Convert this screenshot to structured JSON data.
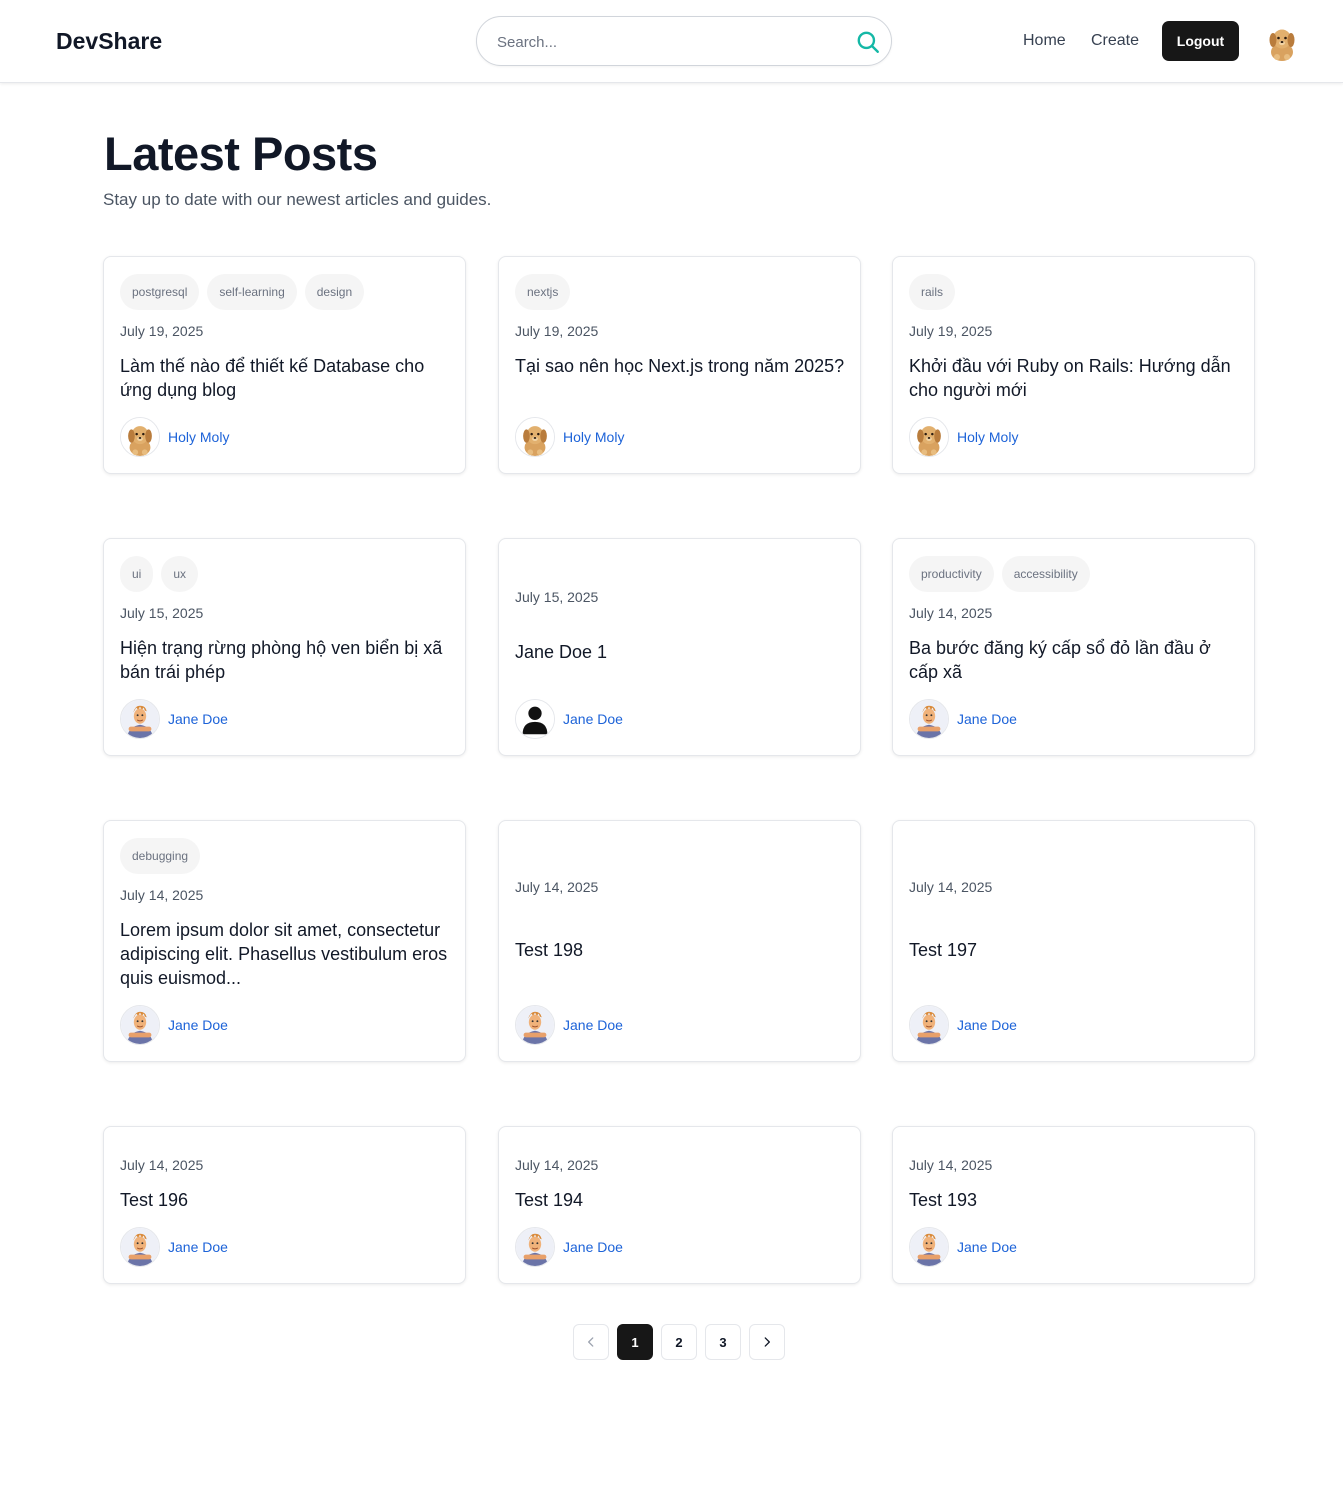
{
  "header": {
    "logo": "DevShare",
    "search_placeholder": "Search...",
    "nav": {
      "home": "Home",
      "create": "Create",
      "logout": "Logout"
    },
    "accent_color": "#14b8a6"
  },
  "intro": {
    "title": "Latest Posts",
    "subtitle": "Stay up to date with our newest articles and guides."
  },
  "posts": [
    {
      "tags": [
        "postgresql",
        "self-learning",
        "design"
      ],
      "date": "July 19, 2025",
      "title": "Làm thế nào để thiết kế Database cho ứng dụng blog",
      "author": "Holy Moly",
      "avatar": "dog"
    },
    {
      "tags": [
        "nextjs"
      ],
      "date": "July 19, 2025",
      "title": "Tại sao nên học Next.js trong năm 2025?",
      "author": "Holy Moly",
      "avatar": "dog"
    },
    {
      "tags": [
        "rails"
      ],
      "date": "July 19, 2025",
      "title": "Khởi đầu với Ruby on Rails: Hướng dẫn cho người mới",
      "author": "Holy Moly",
      "avatar": "dog"
    },
    {
      "tags": [
        "ui",
        "ux"
      ],
      "date": "July 15, 2025",
      "title": "Hiện trạng rừng phòng hộ ven biển bị xã bán trái phép",
      "author": "Jane Doe",
      "avatar": "cartoon"
    },
    {
      "tags": [],
      "date": "July 15, 2025",
      "title": "Jane Doe 1",
      "author": "Jane Doe",
      "avatar": "default"
    },
    {
      "tags": [
        "productivity",
        "accessibility"
      ],
      "date": "July 14, 2025",
      "title": "Ba bước đăng ký cấp sổ đỏ lần đầu ở cấp xã",
      "author": "Jane Doe",
      "avatar": "cartoon"
    },
    {
      "tags": [
        "debugging"
      ],
      "date": "July 14, 2025",
      "title": "Lorem ipsum dolor sit amet, consectetur adipiscing elit. Phasellus vestibulum eros quis euismod...",
      "author": "Jane Doe",
      "avatar": "cartoon"
    },
    {
      "tags": [],
      "date": "July 14, 2025",
      "title": "Test 198",
      "author": "Jane Doe",
      "avatar": "cartoon"
    },
    {
      "tags": [],
      "date": "July 14, 2025",
      "title": "Test 197",
      "author": "Jane Doe",
      "avatar": "cartoon"
    },
    {
      "tags": [],
      "date": "July 14, 2025",
      "title": "Test 196",
      "author": "Jane Doe",
      "avatar": "cartoon"
    },
    {
      "tags": [],
      "date": "July 14, 2025",
      "title": "Test 194",
      "author": "Jane Doe",
      "avatar": "cartoon"
    },
    {
      "tags": [],
      "date": "July 14, 2025",
      "title": "Test 193",
      "author": "Jane Doe",
      "avatar": "cartoon"
    }
  ],
  "pagination": {
    "pages": [
      "1",
      "2",
      "3"
    ],
    "current": "1",
    "prev_icon": "chevron-left-icon",
    "next_icon": "chevron-right-icon"
  }
}
